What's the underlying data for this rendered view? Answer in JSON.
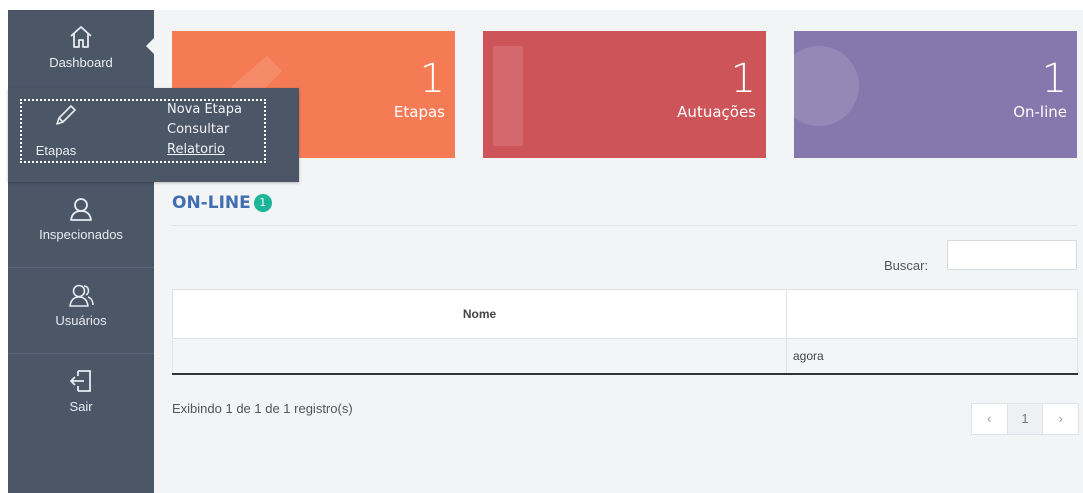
{
  "sidebar": {
    "items": [
      {
        "label": "Dashboard",
        "icon": "home-icon"
      },
      {
        "label": "Etapas",
        "icon": "pencil-icon"
      },
      {
        "label": "Inspecionados",
        "icon": "user-icon"
      },
      {
        "label": "Usuários",
        "icon": "users-icon"
      },
      {
        "label": "Sair",
        "icon": "logout-icon"
      }
    ],
    "submenu": [
      "Nova Etapa",
      "Consultar",
      "Relatorio"
    ]
  },
  "tiles": [
    {
      "count": "1",
      "label": "Etapas",
      "color": "#f57b55"
    },
    {
      "count": "1",
      "label": "Autuações",
      "color": "#cd5458"
    },
    {
      "count": "1",
      "label": "On-line",
      "color": "#8677ad"
    }
  ],
  "online": {
    "title": "ON-LINE",
    "badge": "1"
  },
  "search": {
    "label": "Buscar:",
    "value": ""
  },
  "table": {
    "headers": [
      "Nome",
      ""
    ],
    "rows": [
      [
        "",
        "agora"
      ]
    ]
  },
  "footer": {
    "info": "Exibindo 1 de 1 de 1 registro(s)"
  },
  "pagination": {
    "prev": "‹",
    "page": "1",
    "next": "›"
  },
  "colors": {
    "sidebar": "#4b5667",
    "accent": "#3f6fb2",
    "badge": "#1bb59a"
  }
}
